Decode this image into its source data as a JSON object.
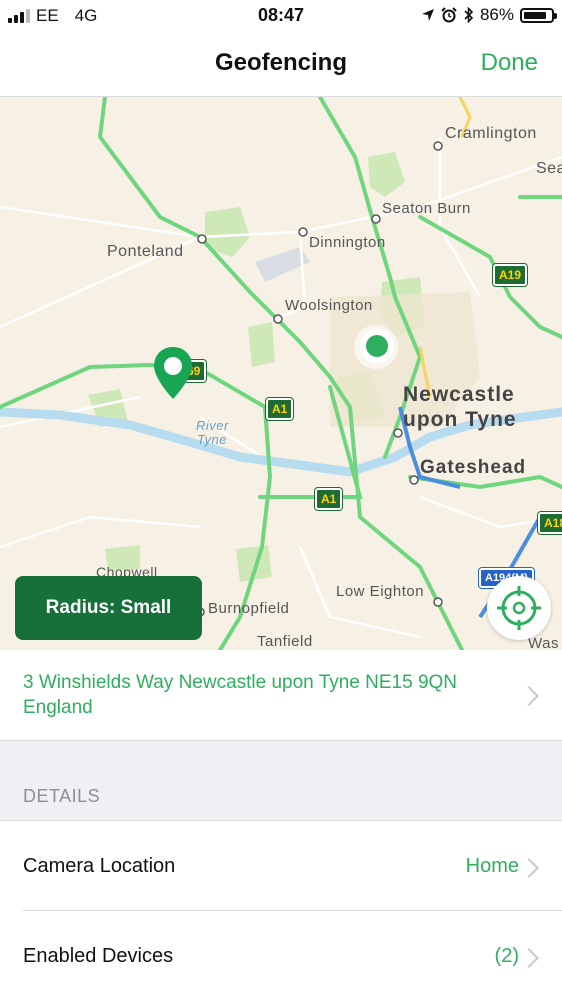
{
  "status": {
    "carrier": "EE",
    "network": "4G",
    "time": "08:47",
    "battery_percent": "86%",
    "battery_level": 0.86,
    "icons": [
      "location-arrow-icon",
      "alarm-icon",
      "bluetooth-icon"
    ]
  },
  "nav": {
    "title": "Geofencing",
    "done_label": "Done"
  },
  "map": {
    "labels": {
      "cramlington": "Cramlington",
      "sea": "Sea",
      "seaton_burn": "Seaton Burn",
      "ponteland": "Ponteland",
      "dinnington": "Dinnington",
      "woolsington": "Woolsington",
      "newcastle_line1": "Newcastle",
      "newcastle_line2": "upon Tyne",
      "gateshead": "Gateshead",
      "river": "River",
      "tyne": "Tyne",
      "chopwell": "Chopwell",
      "burnopfield": "Burnopfield",
      "low_eighton": "Low Eighton",
      "tanfield": "Tanfield",
      "was": "Was"
    },
    "shields": {
      "a19": "A19",
      "a1_a": "A1",
      "a1_b": "A1",
      "a69": "69",
      "a18": "A18",
      "a194": "A194(M)"
    },
    "radius_button": "Radius: Small"
  },
  "address": {
    "text": "3 Winshields Way Newcastle upon Tyne NE15 9QN England"
  },
  "details": {
    "header": "DETAILS",
    "camera_location": {
      "label": "Camera Location",
      "value": "Home"
    },
    "enabled_devices": {
      "label": "Enabled Devices",
      "value": "(2)"
    }
  },
  "colors": {
    "accent": "#2fae5f",
    "button_green": "#17703a",
    "road_green": "#6fd67f",
    "water": "#b7dcf0"
  }
}
